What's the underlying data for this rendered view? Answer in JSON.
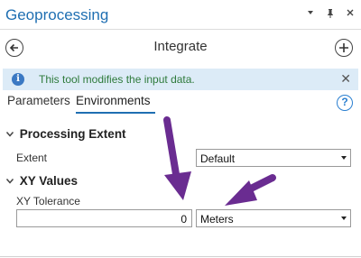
{
  "window": {
    "title": "Geoprocessing",
    "controls": [
      "chevron-down-icon",
      "pin-icon",
      "close-icon"
    ]
  },
  "tool": {
    "name": "Integrate"
  },
  "info": {
    "message": "This tool modifies the input data.",
    "icon": "info-icon",
    "icon_glyph": "i",
    "close_glyph": "✕"
  },
  "tabs": [
    {
      "label": "Parameters",
      "active": false
    },
    {
      "label": "Environments",
      "active": true
    }
  ],
  "help": {
    "glyph": "?"
  },
  "sections": {
    "processing_extent": {
      "title": "Processing Extent",
      "extent_label": "Extent",
      "extent_value": "Default"
    },
    "xy_values": {
      "title": "XY Values",
      "tolerance_label": "XY Tolerance",
      "tolerance_value": "0",
      "units_value": "Meters"
    }
  },
  "annotations": {
    "arrow_color": "#6a2c91"
  },
  "colors": {
    "accent": "#1f6fb2",
    "info_bg": "#dcebf7",
    "info_text": "#2e7a3b"
  }
}
